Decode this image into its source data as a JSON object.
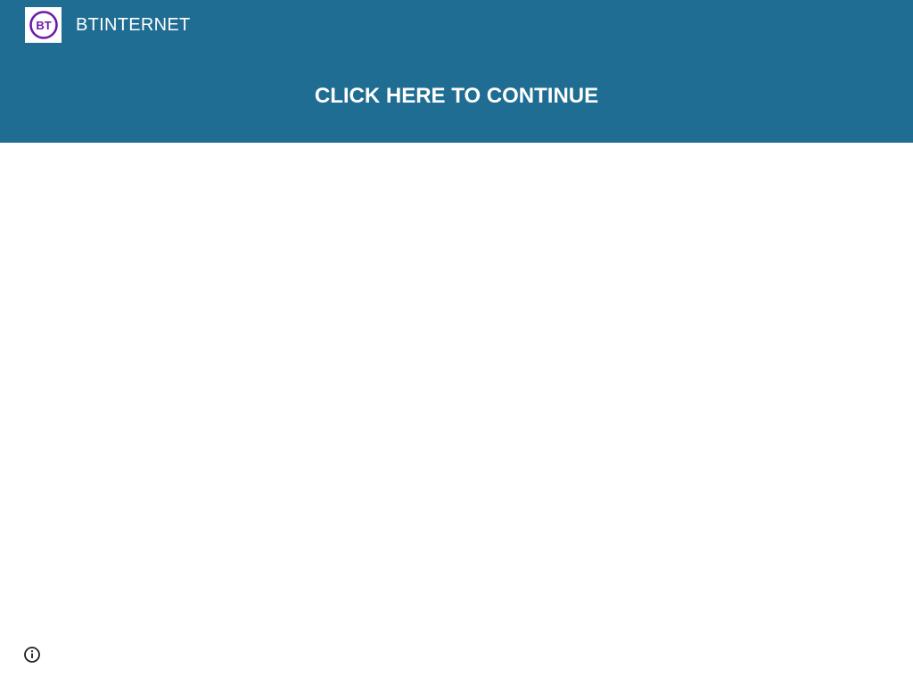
{
  "header": {
    "site_title": "BTINTERNET",
    "logo_text": "BT",
    "cta_label": "CLICK HERE TO CONTINUE"
  },
  "footer": {
    "info_icon": "info-icon"
  },
  "colors": {
    "header_bg": "#1f6d93",
    "logo_accent": "#6e1aa8",
    "page_bg": "#ffffff"
  }
}
